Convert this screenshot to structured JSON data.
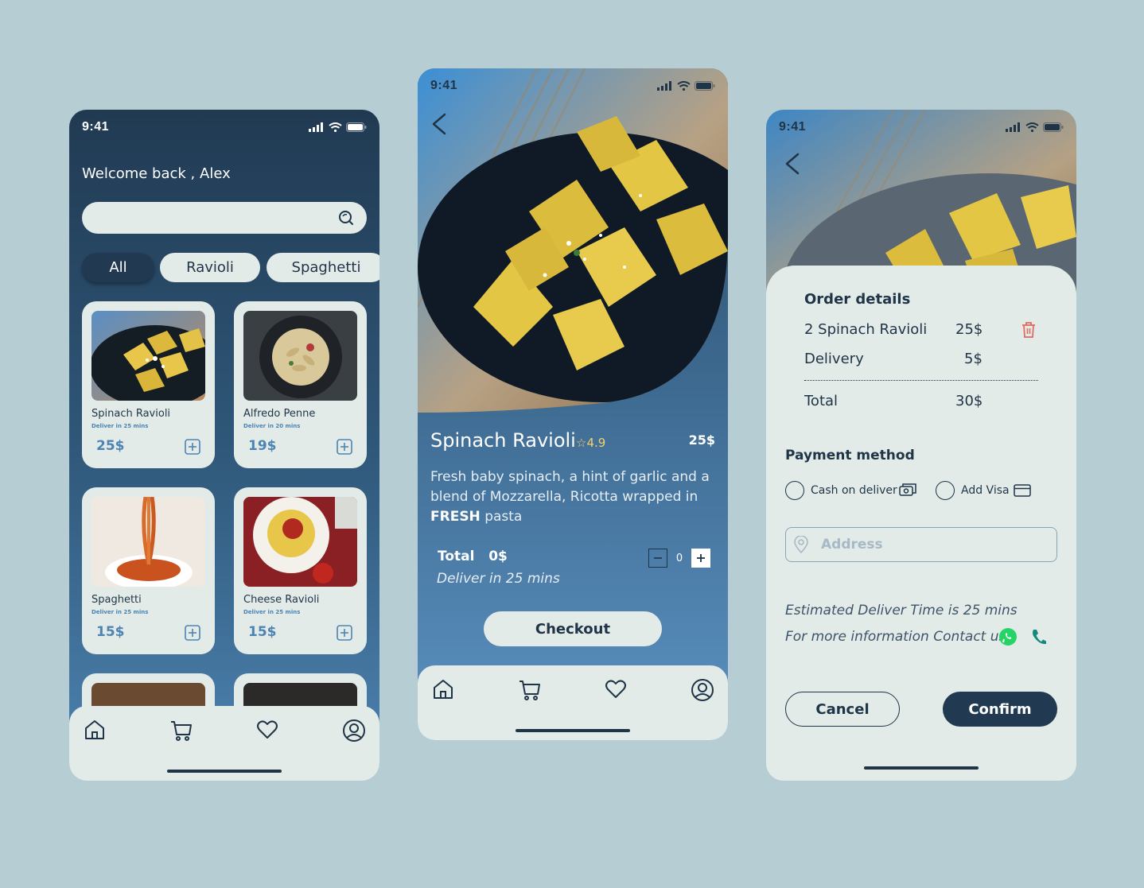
{
  "status": {
    "time": "9:41"
  },
  "home": {
    "welcome": "Welcome back , Alex",
    "search_placeholder": "",
    "chips": [
      "All",
      "Ravioli",
      "Spaghetti"
    ],
    "cards": [
      {
        "name": "Spinach Ravioli",
        "delivery": "Deliver in 25 mins",
        "price": "25$"
      },
      {
        "name": "Alfredo Penne",
        "delivery": "Deliver in 20 mins",
        "price": "19$"
      },
      {
        "name": "Spaghetti",
        "delivery": "Deliver in 25 mins",
        "price": "15$"
      },
      {
        "name": "Cheese Ravioli",
        "delivery": "Deliver in 25 mins",
        "price": "15$"
      }
    ]
  },
  "detail": {
    "title": "Spinach Ravioli",
    "rating": "4.9",
    "price": "25$",
    "desc_main": "Fresh baby spinach, a hint of garlic and a blend of Mozzarella, Ricotta wrapped in",
    "desc_bold": "FRESH",
    "desc_end": "pasta",
    "total_label": "Total",
    "total_value": "0$",
    "deliver": "Deliver in 25 mins",
    "quantity": "0",
    "checkout": "Checkout"
  },
  "order": {
    "heading": "Order details",
    "item_label": "2 Spinach Ravioli",
    "item_price": "25$",
    "delivery_label": "Delivery",
    "delivery_price": "5$",
    "total_label": "Total",
    "total_price": "30$",
    "payment_heading": "Payment method",
    "cash_label": "Cash on deliver",
    "visa_label": "Add Visa",
    "address_placeholder": "Address",
    "estimate": "Estimated Deliver Time is 25 mins",
    "contact": "For more information Contact us",
    "cancel": "Cancel",
    "confirm": "Confirm"
  },
  "colors": {
    "navy": "#213a52",
    "accent_blue": "#4d84b2",
    "panel": "#e2ebe8",
    "star": "#f2d16b",
    "delete_red": "#e36a5e",
    "whatsapp": "#25d366",
    "phone_teal": "#138a7c"
  },
  "icons": [
    "search-icon",
    "plus-square-icon",
    "home-icon",
    "cart-icon",
    "heart-icon",
    "profile-icon",
    "back-arrow-icon",
    "star-icon",
    "minus-square-icon",
    "trash-icon",
    "cash-icon",
    "card-icon",
    "location-pin-icon",
    "whatsapp-icon",
    "phone-icon",
    "signal-icon",
    "wifi-icon",
    "battery-icon"
  ]
}
